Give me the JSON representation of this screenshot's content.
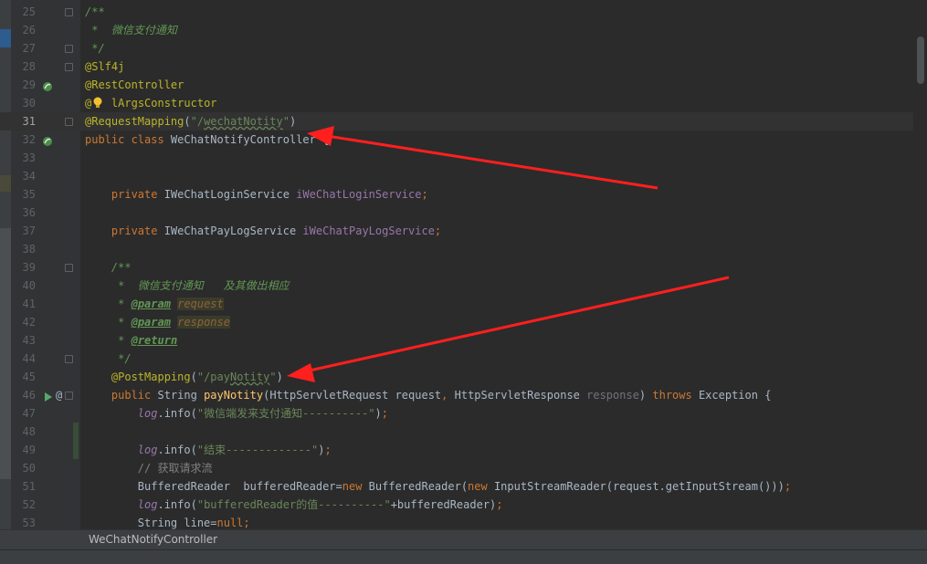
{
  "colors": {
    "arrow": "#ff1f1f",
    "keyword": "#cc7832",
    "annotation": "#bbb529",
    "string": "#6a8759",
    "field": "#9876aa",
    "doc_comment": "#629755",
    "method_decl": "#ffc66d",
    "background": "#2b2b2b",
    "gutter": "#313335"
  },
  "current_line": "31",
  "lines": [
    {
      "num": "25",
      "fold": true,
      "tokens": [
        {
          "c": "t-dc",
          "t": "/**"
        }
      ]
    },
    {
      "num": "26",
      "tokens": [
        {
          "c": "t-dc",
          "t": " *  微信支付通知"
        }
      ]
    },
    {
      "num": "27",
      "fold": true,
      "tokens": [
        {
          "c": "t-dc",
          "t": " */"
        }
      ]
    },
    {
      "num": "28",
      "fold": true,
      "tokens": [
        {
          "c": "t-ann",
          "t": "@Slf4j"
        }
      ]
    },
    {
      "num": "29",
      "icon": "spring-bean-icon",
      "tokens": [
        {
          "c": "t-ann",
          "t": "@RestController"
        }
      ]
    },
    {
      "num": "30",
      "bulb": true,
      "tokens": [
        {
          "c": "t-ann",
          "t": "@"
        },
        {
          "c": "t-ann",
          "t": "   "
        },
        {
          "c": "t-ann",
          "t": "lArgsConstructor"
        }
      ]
    },
    {
      "num": "31",
      "fold": true,
      "tokens": [
        {
          "c": "t-ann",
          "t": "@RequestMapping"
        },
        {
          "c": "",
          "t": "("
        },
        {
          "c": "t-str",
          "t": "\"/"
        },
        {
          "c": "t-str t-squig",
          "t": "wechatNotity"
        },
        {
          "c": "t-str",
          "t": "\""
        },
        {
          "c": "",
          "t": ")"
        }
      ]
    },
    {
      "num": "32",
      "icon": "spring-controller-icon",
      "tokens": [
        {
          "c": "t-kw",
          "t": "public class "
        },
        {
          "c": "",
          "t": "WeChatNotifyController {"
        }
      ]
    },
    {
      "num": "33",
      "tokens": []
    },
    {
      "num": "34",
      "tokens": []
    },
    {
      "num": "35",
      "tokens": [
        {
          "c": "",
          "t": "    "
        },
        {
          "c": "t-kw",
          "t": "private "
        },
        {
          "c": "",
          "t": "IWeChatLoginService "
        },
        {
          "c": "t-field",
          "t": "iWeChatLoginService"
        },
        {
          "c": "t-kw",
          "t": ";"
        }
      ]
    },
    {
      "num": "36",
      "tokens": []
    },
    {
      "num": "37",
      "tokens": [
        {
          "c": "",
          "t": "    "
        },
        {
          "c": "t-kw",
          "t": "private "
        },
        {
          "c": "",
          "t": "IWeChatPayLogService "
        },
        {
          "c": "t-field",
          "t": "iWeChatPayLogService"
        },
        {
          "c": "t-kw",
          "t": ";"
        }
      ]
    },
    {
      "num": "38",
      "tokens": []
    },
    {
      "num": "39",
      "fold": true,
      "tokens": [
        {
          "c": "",
          "t": "    "
        },
        {
          "c": "t-dc",
          "t": "/**"
        }
      ]
    },
    {
      "num": "40",
      "tokens": [
        {
          "c": "",
          "t": "    "
        },
        {
          "c": "t-dc",
          "t": " *  微信支付通知   及其做出相应"
        }
      ]
    },
    {
      "num": "41",
      "tokens": [
        {
          "c": "",
          "t": "    "
        },
        {
          "c": "t-dc",
          "t": " * "
        },
        {
          "c": "t-dct",
          "t": "@param"
        },
        {
          "c": "t-dc",
          "t": " "
        },
        {
          "c": "t-dcp",
          "t": "request"
        }
      ]
    },
    {
      "num": "42",
      "tokens": [
        {
          "c": "",
          "t": "    "
        },
        {
          "c": "t-dc",
          "t": " * "
        },
        {
          "c": "t-dct",
          "t": "@param"
        },
        {
          "c": "t-dc",
          "t": " "
        },
        {
          "c": "t-dcp",
          "t": "response"
        }
      ]
    },
    {
      "num": "43",
      "tokens": [
        {
          "c": "",
          "t": "    "
        },
        {
          "c": "t-dc",
          "t": " * "
        },
        {
          "c": "t-dct",
          "t": "@return"
        }
      ]
    },
    {
      "num": "44",
      "fold": true,
      "tokens": [
        {
          "c": "",
          "t": "    "
        },
        {
          "c": "t-dc",
          "t": " */"
        }
      ]
    },
    {
      "num": "45",
      "tokens": [
        {
          "c": "",
          "t": "    "
        },
        {
          "c": "t-ann",
          "t": "@PostMapping"
        },
        {
          "c": "",
          "t": "("
        },
        {
          "c": "t-str",
          "t": "\"/pay"
        },
        {
          "c": "t-str t-squig",
          "t": "Notity"
        },
        {
          "c": "t-str",
          "t": "\""
        },
        {
          "c": "",
          "t": ")"
        }
      ]
    },
    {
      "num": "46",
      "run": true,
      "at": "@",
      "fold": true,
      "tokens": [
        {
          "c": "",
          "t": "    "
        },
        {
          "c": "t-kw",
          "t": "public "
        },
        {
          "c": "",
          "t": "String "
        },
        {
          "c": "t-fn",
          "t": "payNotity"
        },
        {
          "c": "",
          "t": "(HttpServletRequest request"
        },
        {
          "c": "t-kw",
          "t": ", "
        },
        {
          "c": "",
          "t": "HttpServletResponse "
        },
        {
          "c": "t-gray",
          "t": "response"
        },
        {
          "c": "",
          "t": ") "
        },
        {
          "c": "t-kw",
          "t": "throws "
        },
        {
          "c": "",
          "t": "Exception {"
        }
      ]
    },
    {
      "num": "47",
      "tokens": [
        {
          "c": "",
          "t": "        "
        },
        {
          "c": "t-logv",
          "t": "log"
        },
        {
          "c": "",
          "t": ".info("
        },
        {
          "c": "t-str",
          "t": "\"微信端发来支付通知----------\""
        },
        {
          "c": "",
          "t": ")"
        },
        {
          "c": "t-kw",
          "t": ";"
        }
      ]
    },
    {
      "num": "48",
      "changed": true,
      "tokens": []
    },
    {
      "num": "49",
      "changed": true,
      "tokens": [
        {
          "c": "",
          "t": "        "
        },
        {
          "c": "t-logv",
          "t": "log"
        },
        {
          "c": "",
          "t": ".info("
        },
        {
          "c": "t-str",
          "t": "\"结束-------------\""
        },
        {
          "c": "",
          "t": ")"
        },
        {
          "c": "t-kw",
          "t": ";"
        }
      ]
    },
    {
      "num": "50",
      "tokens": [
        {
          "c": "",
          "t": "        "
        },
        {
          "c": "t-cm",
          "t": "// 获取请求流"
        }
      ]
    },
    {
      "num": "51",
      "tokens": [
        {
          "c": "",
          "t": "        BufferedReader  bufferedReader="
        },
        {
          "c": "t-kw",
          "t": "new "
        },
        {
          "c": "",
          "t": "BufferedReader("
        },
        {
          "c": "t-kw",
          "t": "new "
        },
        {
          "c": "",
          "t": "InputStreamReader(request.getInputStream()))"
        },
        {
          "c": "t-kw",
          "t": ";"
        }
      ]
    },
    {
      "num": "52",
      "tokens": [
        {
          "c": "",
          "t": "        "
        },
        {
          "c": "t-logv",
          "t": "log"
        },
        {
          "c": "",
          "t": ".info("
        },
        {
          "c": "t-str",
          "t": "\"bufferedReader的值----------\""
        },
        {
          "c": "",
          "t": "+bufferedReader)"
        },
        {
          "c": "t-kw",
          "t": ";"
        }
      ]
    },
    {
      "num": "53",
      "tokens": [
        {
          "c": "",
          "t": "        String line="
        },
        {
          "c": "t-kw",
          "t": "null;"
        }
      ]
    }
  ],
  "breadcrumb": "WeChatNotifyController"
}
